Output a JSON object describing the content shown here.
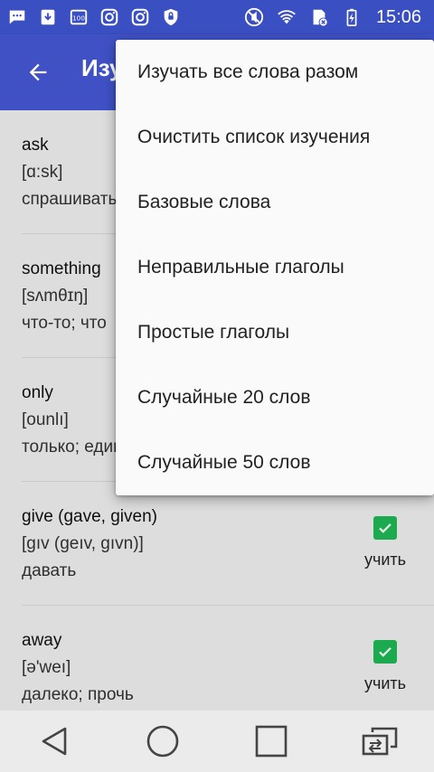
{
  "status_bar": {
    "time": "15:06",
    "icons_left": [
      "message-icon",
      "download-icon",
      "storage-icon",
      "instagram-icon",
      "instagram-icon",
      "shield-icon"
    ],
    "icons_right": [
      "mute-icon",
      "wifi-icon",
      "sim-icon",
      "battery-charging-icon"
    ]
  },
  "app_bar": {
    "title": "Изучение",
    "back_icon": "arrow-left-icon",
    "color": "#3f51c5"
  },
  "menu": {
    "items": [
      "Изучать все слова разом",
      "Очистить список изучения",
      "Базовые слова",
      "Неправильные глаголы",
      "Простые глаголы",
      "Случайные 20 слов",
      "Случайные 50 слов"
    ]
  },
  "words": [
    {
      "word": "ask",
      "transcription": "[ɑ:sk]",
      "meaning": "спрашивать"
    },
    {
      "word": "something",
      "transcription": "[sʌmθɪŋ]",
      "meaning": "что-то; что"
    },
    {
      "word": "only",
      "transcription": "[ounlı]",
      "meaning": "только; единственный"
    },
    {
      "word": "give (gave, given)",
      "transcription": "[gıv (geıv, gıvn)]",
      "meaning": "давать",
      "learn_label": "учить",
      "checked": true
    },
    {
      "word": "away",
      "transcription": "[ə'weı]",
      "meaning": "далеко; прочь",
      "learn_label": "учить",
      "checked": true
    }
  ],
  "nav_bar": {
    "buttons": [
      "back-icon",
      "home-icon",
      "recents-icon",
      "switch-app-icon"
    ]
  },
  "colors": {
    "accent": "#3f51c5",
    "checkbox": "#1eb854"
  }
}
